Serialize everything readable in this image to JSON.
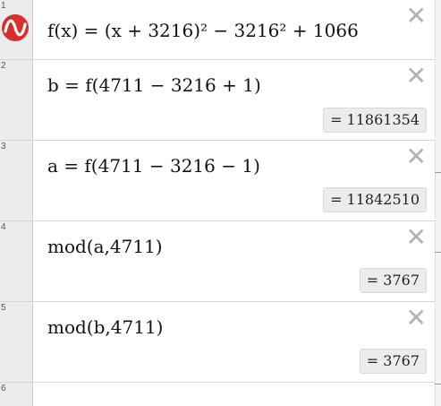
{
  "rows": [
    {
      "number": "1",
      "expression": "f(x) = (x + 3216)² − 3216² + 1066",
      "result": ""
    },
    {
      "number": "2",
      "expression": "b = f(4711 − 3216 + 1)",
      "result": "= 11861354"
    },
    {
      "number": "3",
      "expression": "a = f(4711 − 3216 − 1)",
      "result": "= 11842510"
    },
    {
      "number": "4",
      "expression": "mod(a,4711)",
      "result": "= 3767"
    },
    {
      "number": "5",
      "expression": "mod(b,4711)",
      "result": "= 3767"
    },
    {
      "number": "6",
      "expression": "",
      "result": ""
    }
  ],
  "close_glyph": "✕",
  "logo_icon": "desmos-logo-icon",
  "colors": {
    "logo": "#d8302b",
    "gutter": "#ececec",
    "result_bg": "#ececec"
  }
}
